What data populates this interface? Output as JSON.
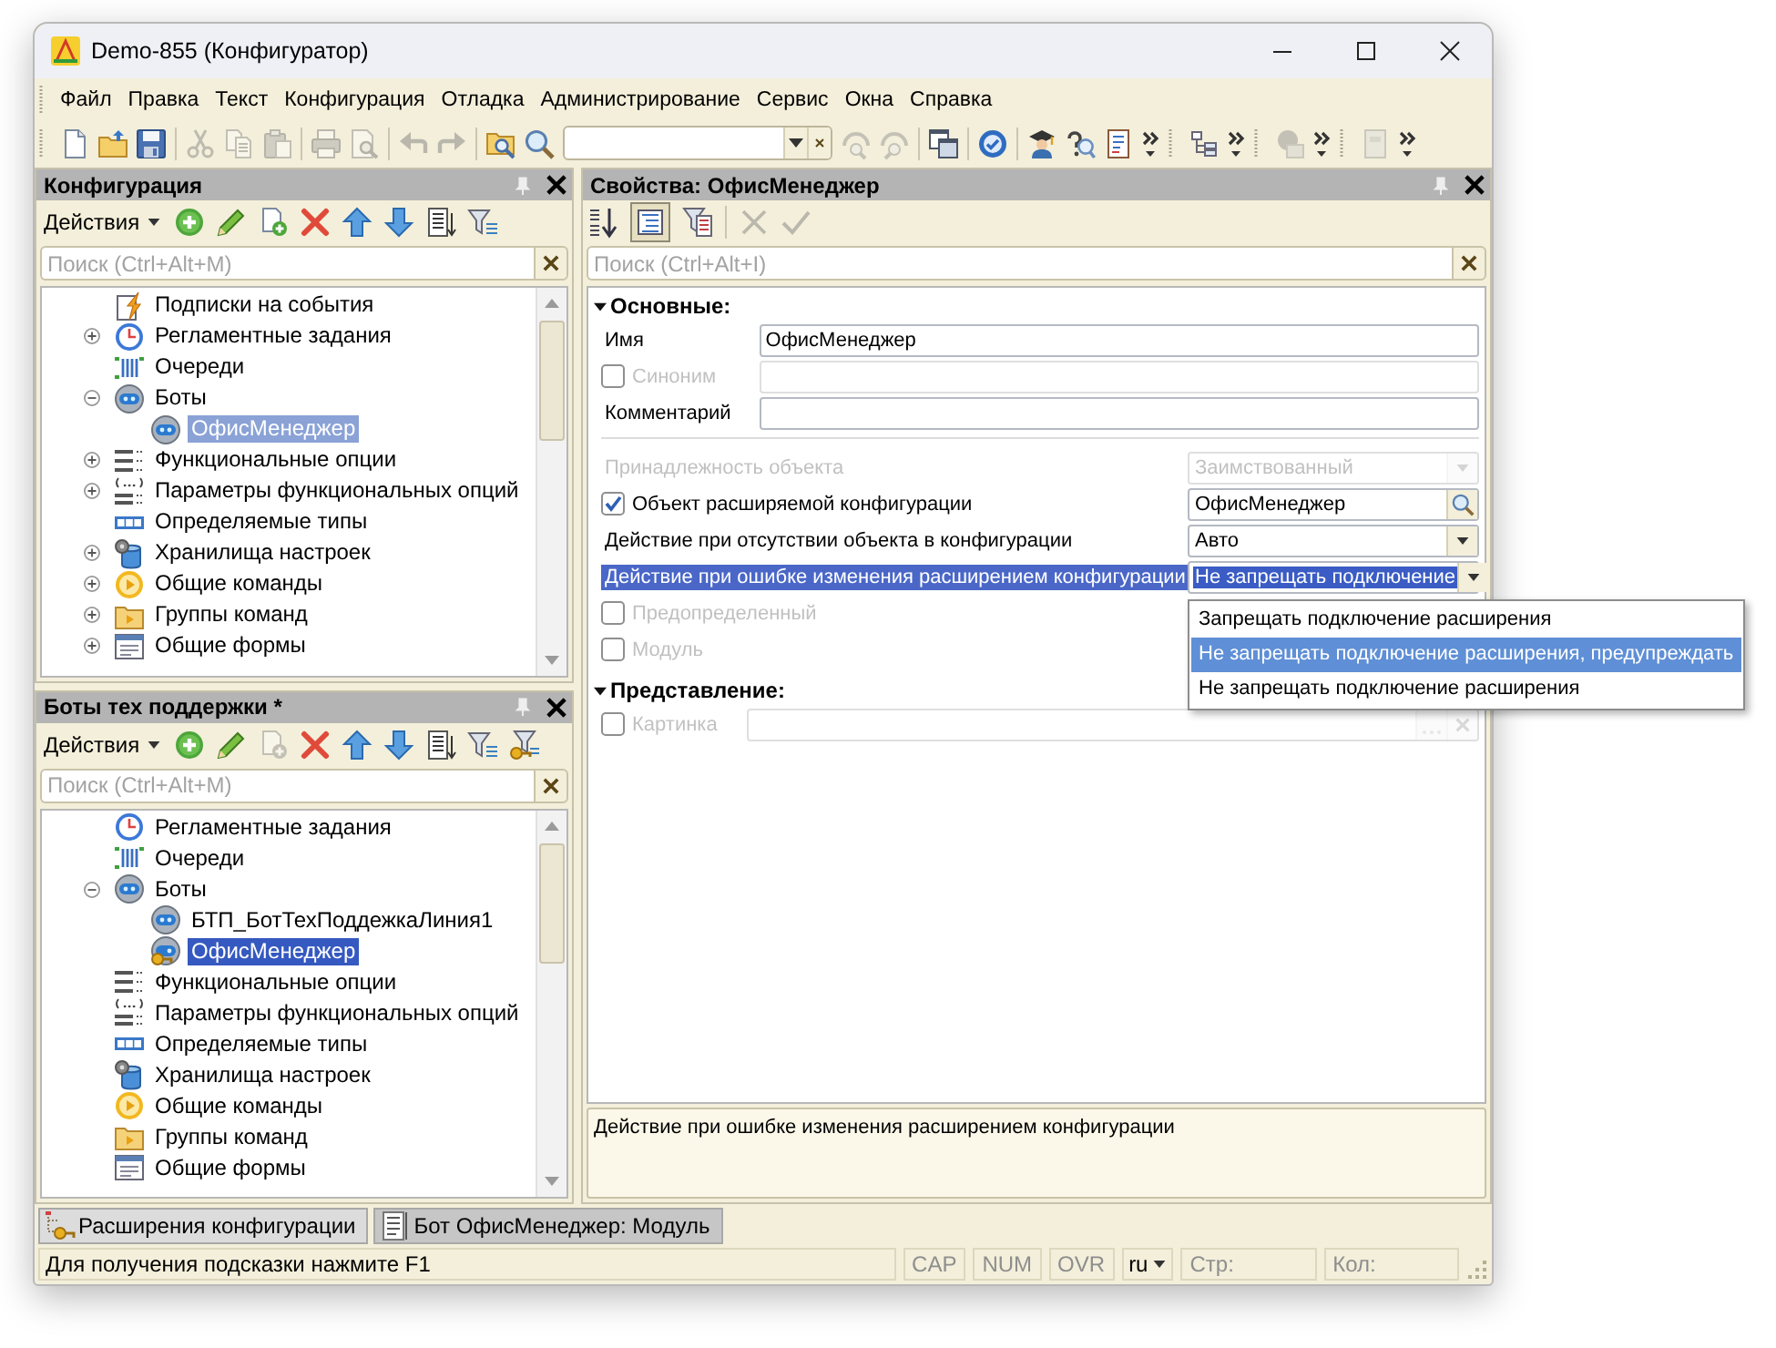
{
  "window": {
    "title": "Demo-855 (Конфигуратор)"
  },
  "menu": [
    "Файл",
    "Правка",
    "Текст",
    "Конфигурация",
    "Отладка",
    "Администрирование",
    "Сервис",
    "Окна",
    "Справка"
  ],
  "toolbar": [
    {
      "kind": "grip"
    },
    {
      "kind": "new",
      "disabled": false
    },
    {
      "kind": "open",
      "disabled": false
    },
    {
      "kind": "save",
      "disabled": false
    },
    {
      "kind": "separator"
    },
    {
      "kind": "cut",
      "disabled": true
    },
    {
      "kind": "copy",
      "disabled": true
    },
    {
      "kind": "paste",
      "disabled": true
    },
    {
      "kind": "separator"
    },
    {
      "kind": "print",
      "disabled": true
    },
    {
      "kind": "preview",
      "disabled": true
    },
    {
      "kind": "separator"
    },
    {
      "kind": "undo",
      "disabled": true
    },
    {
      "kind": "redo",
      "disabled": true
    },
    {
      "kind": "separator"
    },
    {
      "kind": "findfolder",
      "disabled": false
    },
    {
      "kind": "search",
      "disabled": false
    },
    {
      "kind": "combo"
    },
    {
      "kind": "findnext",
      "disabled": true
    },
    {
      "kind": "findprev",
      "disabled": true
    },
    {
      "kind": "separator"
    },
    {
      "kind": "windows",
      "disabled": false
    },
    {
      "kind": "separator"
    },
    {
      "kind": "check",
      "disabled": false
    },
    {
      "kind": "separator"
    },
    {
      "kind": "graduate",
      "disabled": false
    },
    {
      "kind": "helpsearch",
      "disabled": false
    },
    {
      "kind": "doc",
      "disabled": false
    },
    {
      "kind": "more",
      "disabled": false
    },
    {
      "kind": "grip"
    },
    {
      "kind": "cfgtree",
      "disabled": false
    },
    {
      "kind": "more",
      "disabled": false
    },
    {
      "kind": "grip"
    },
    {
      "kind": "modsym",
      "disabled": true
    },
    {
      "kind": "more",
      "disabled": false
    },
    {
      "kind": "grip"
    },
    {
      "kind": "calc",
      "disabled": true
    },
    {
      "kind": "more",
      "disabled": false
    }
  ],
  "panels": [
    {
      "title": "Конфигурация",
      "focused": false,
      "actions": "Действия",
      "tools": [
        {
          "kind": "add",
          "disabled": false
        },
        {
          "kind": "edit",
          "disabled": false
        },
        {
          "kind": "copyadd",
          "disabled": false
        },
        {
          "kind": "delete",
          "disabled": false
        },
        {
          "kind": "up",
          "disabled": false
        },
        {
          "kind": "down",
          "disabled": false
        },
        {
          "kind": "list",
          "disabled": false
        },
        {
          "kind": "filter",
          "disabled": false
        }
      ],
      "search": {
        "placeholder": "Поиск (Ctrl+Alt+M)"
      },
      "tree": [
        {
          "label": "Подписки на события",
          "kind": "subscription",
          "selected": false
        },
        {
          "label": "Регламентные задания",
          "kind": "schedule",
          "expanded": false,
          "selected": false
        },
        {
          "label": "Очереди",
          "kind": "queue",
          "selected": false
        },
        {
          "label": "Боты",
          "kind": "bot",
          "expanded": true,
          "selected": false,
          "children": [
            {
              "label": "ОфисМенеджер",
              "kind": "bot",
              "selected": true
            }
          ]
        },
        {
          "label": "Функциональные опции",
          "kind": "option",
          "expanded": false,
          "selected": false
        },
        {
          "label": "Параметры функциональных опций",
          "kind": "parameter",
          "expanded": false,
          "selected": false
        },
        {
          "label": "Определяемые типы",
          "kind": "type",
          "selected": false
        },
        {
          "label": "Хранилища настроек",
          "kind": "storage",
          "expanded": false,
          "selected": false
        },
        {
          "label": "Общие команды",
          "kind": "command",
          "expanded": false,
          "selected": false
        },
        {
          "label": "Группы команд",
          "kind": "group",
          "expanded": false,
          "selected": false
        },
        {
          "label": "Общие формы",
          "kind": "form",
          "expanded": false,
          "selected": false
        }
      ]
    },
    {
      "title": "Боты тех поддержки *",
      "focused": true,
      "actions": "Действия",
      "tools": [
        {
          "kind": "add",
          "disabled": false
        },
        {
          "kind": "edit",
          "disabled": false
        },
        {
          "kind": "copyadd",
          "disabled": true
        },
        {
          "kind": "delete",
          "disabled": false
        },
        {
          "kind": "up",
          "disabled": false
        },
        {
          "kind": "down",
          "disabled": false
        },
        {
          "kind": "list",
          "disabled": false
        },
        {
          "kind": "filter",
          "disabled": false
        },
        {
          "kind": "filterkey",
          "disabled": false
        }
      ],
      "search": {
        "placeholder": "Поиск (Ctrl+Alt+M)"
      },
      "tree": [
        {
          "label": "Регламентные задания",
          "kind": "schedule",
          "selected": false
        },
        {
          "label": "Очереди",
          "kind": "queue",
          "selected": false
        },
        {
          "label": "Боты",
          "kind": "bot",
          "expanded": true,
          "selected": false,
          "children": [
            {
              "label": "БТП_БотТехПоддежкаЛиния1",
              "kind": "bot",
              "selected": false
            },
            {
              "label": "ОфисМенеджер",
              "kind": "extbot",
              "selected": true
            }
          ]
        },
        {
          "label": "Функциональные опции",
          "kind": "option",
          "selected": false
        },
        {
          "label": "Параметры функциональных опций",
          "kind": "parameter",
          "selected": false
        },
        {
          "label": "Определяемые типы",
          "kind": "type",
          "selected": false
        },
        {
          "label": "Хранилища настроек",
          "kind": "storage",
          "selected": false
        },
        {
          "label": "Общие команды",
          "kind": "command",
          "selected": false
        },
        {
          "label": "Группы команд",
          "kind": "group",
          "selected": false
        },
        {
          "label": "Общие формы",
          "kind": "form",
          "selected": false
        }
      ]
    }
  ],
  "properties": {
    "title": "Свойства: ОфисМенеджер",
    "tools": [
      {
        "kind": "sort",
        "pressed": false,
        "disabled": false
      },
      {
        "kind": "categories",
        "pressed": true,
        "disabled": false
      },
      {
        "kind": "filterdoc",
        "pressed": false,
        "disabled": false
      },
      {
        "kind": "separator"
      },
      {
        "kind": "cancel",
        "pressed": false,
        "disabled": true
      },
      {
        "kind": "apply",
        "pressed": false,
        "disabled": true
      }
    ],
    "search": {
      "placeholder": "Поиск (Ctrl+Alt+I)"
    },
    "groups": [
      {
        "title": "Основные:",
        "expanded": true,
        "blocks": [
          {
            "kind": "wide",
            "rows": [
              {
                "label": "Имя",
                "kind": "text",
                "value": "ОфисМенеджер",
                "disabled": false,
                "selected": false
              },
              {
                "label": "Синоним",
                "kind": "text",
                "checked": false,
                "disabled": true,
                "selected": false
              },
              {
                "label": "Комментарий",
                "kind": "text",
                "disabled": false,
                "selected": false
              }
            ]
          },
          {
            "kind": "split",
            "rows": [
              {
                "label": "Принадлежность объекта",
                "kind": "dropdown",
                "value": "Заимствованный",
                "disabled": true,
                "selected": false
              },
              {
                "label": "Объект расширяемой конфигурации",
                "kind": "lookup",
                "checked": true,
                "value": "ОфисМенеджер",
                "disabled": false,
                "selected": false
              },
              {
                "label": "Действие при отсутствии объекта в конфигурации",
                "kind": "dropdown",
                "value": "Авто",
                "disabled": false,
                "selected": false
              },
              {
                "label": "Действие при ошибке изменения расширением конфигурации",
                "kind": "dropdown",
                "value": "Не запрещать подключение",
                "disabled": false,
                "selected": true,
                "options": [
                  {
                    "label": "Запрещать подключение расширения",
                    "selected": false
                  },
                  {
                    "label": "Не запрещать подключение расширения, предупреждать",
                    "selected": true
                  },
                  {
                    "label": "Не запрещать подключение расширения",
                    "selected": false
                  }
                ]
              },
              {
                "label": "Предопределенный",
                "kind": "flag",
                "checked": false,
                "disabled": true,
                "selected": false
              },
              {
                "label": "Модуль",
                "kind": "flag",
                "checked": false,
                "disabled": true,
                "selected": false
              }
            ]
          }
        ]
      },
      {
        "title": "Представление:",
        "expanded": true,
        "blocks": [
          {
            "kind": "wide",
            "rows": [
              {
                "label": "Картинка",
                "kind": "picture",
                "checked": false,
                "disabled": true,
                "selected": false
              }
            ]
          }
        ]
      }
    ],
    "description": "Действие при ошибке изменения расширением конфигурации"
  },
  "tabs": [
    {
      "label": "Расширения конфигурации",
      "kind": "extensions",
      "selected": true
    },
    {
      "label": "Бот ОфисМенеджер: Модуль",
      "kind": "module",
      "selected": false
    }
  ],
  "status_bar": {
    "hint": "Для получения подсказки нажмите F1",
    "indicators": [
      {
        "label": "CAP",
        "on": false
      },
      {
        "label": "NUM",
        "on": false
      },
      {
        "label": "OVR",
        "on": false
      }
    ],
    "language": "ru",
    "line": "Стр:",
    "column": "Кол:"
  }
}
